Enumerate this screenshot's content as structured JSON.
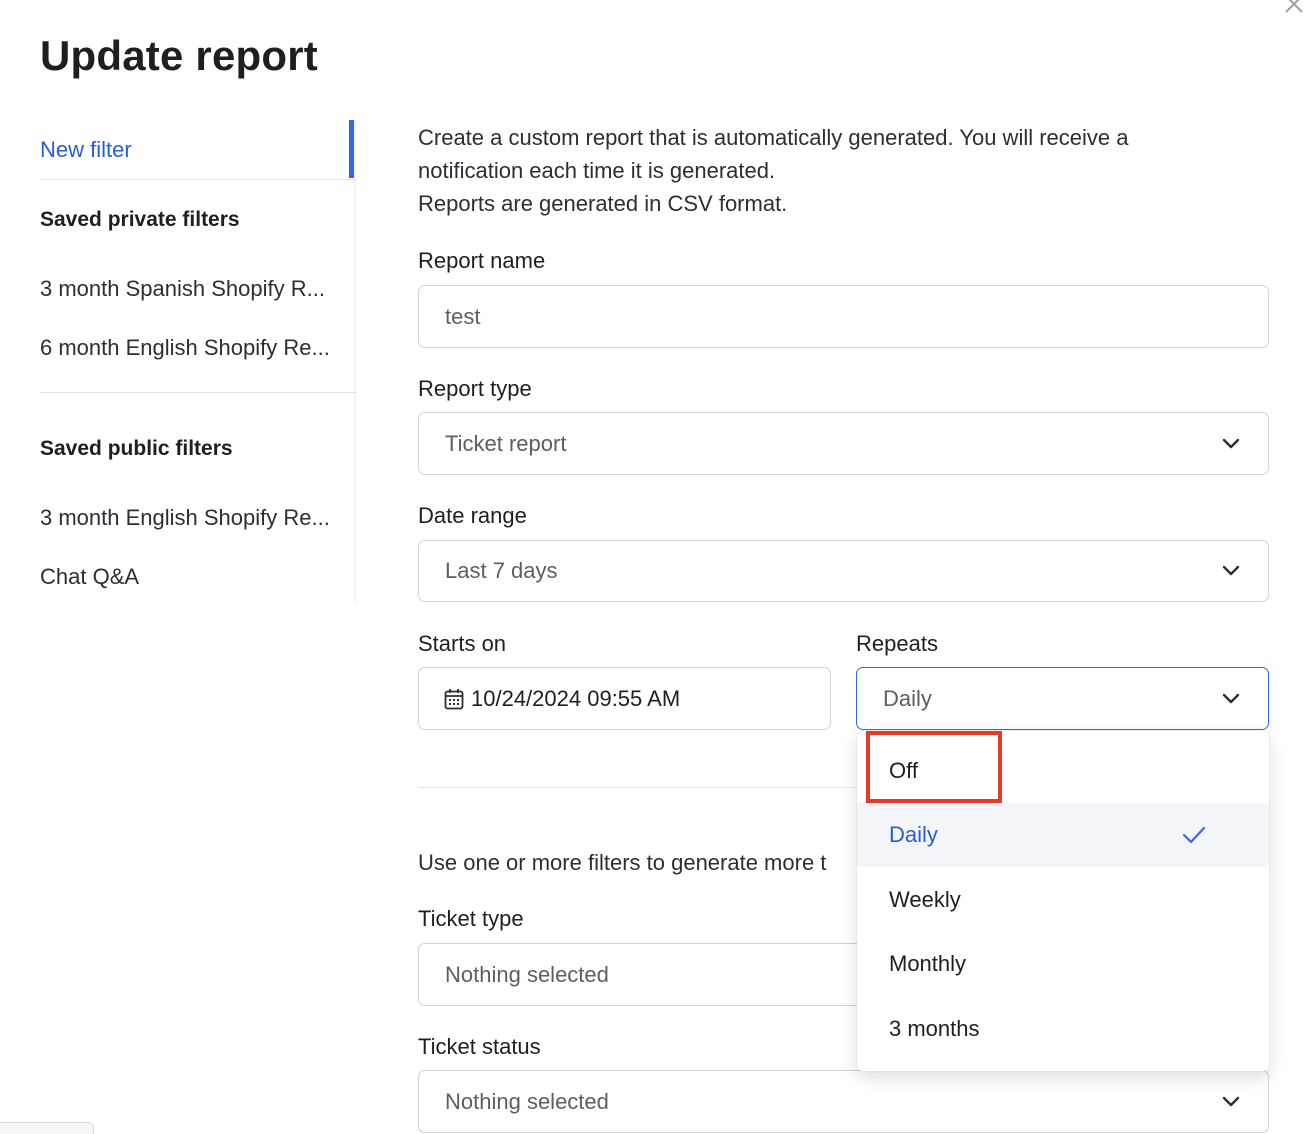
{
  "modal": {
    "title": "Update report"
  },
  "sidebar": {
    "new_filter": "New filter",
    "private_heading": "Saved private filters",
    "private_items": [
      "3 month Spanish Shopify R...",
      "6 month English Shopify Re..."
    ],
    "public_heading": "Saved public filters",
    "public_items": [
      "3 month English Shopify Re...",
      "Chat Q&A"
    ]
  },
  "form": {
    "description": [
      "Create a custom report that is automatically generated. You will receive a",
      "notification each time it is generated.",
      "Reports are generated in CSV format."
    ],
    "report_name": {
      "label": "Report name",
      "value": "test"
    },
    "report_type": {
      "label": "Report type",
      "value": "Ticket report"
    },
    "date_range": {
      "label": "Date range",
      "value": "Last 7 days"
    },
    "starts_on": {
      "label": "Starts on",
      "value": "10/24/2024 09:55 AM"
    },
    "repeats": {
      "label": "Repeats",
      "value": "Daily",
      "options": [
        "Off",
        "Daily",
        "Weekly",
        "Monthly",
        "3 months"
      ],
      "selected": "Daily"
    },
    "filters_intro": "Use one or more filters to generate more t",
    "ticket_type": {
      "label": "Ticket type",
      "value": "Nothing selected"
    },
    "ticket_status": {
      "label": "Ticket status",
      "value": "Nothing selected"
    }
  },
  "colors": {
    "accent": "#3a63f0",
    "link": "#2b5bd6",
    "highlight": "#e53b26"
  },
  "icons": [
    "close-icon",
    "chevron-down-icon",
    "calendar-icon",
    "checkmark-icon"
  ]
}
